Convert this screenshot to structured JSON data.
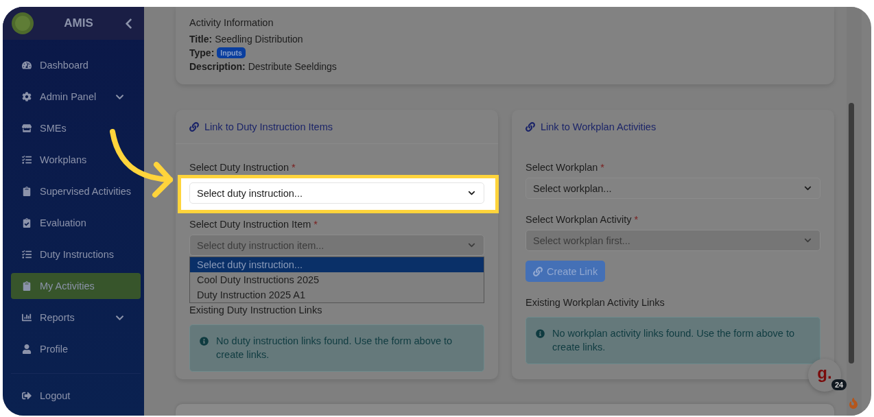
{
  "sidebar": {
    "brand": "AMIS",
    "items": [
      {
        "label": "Dashboard",
        "selected": false,
        "expandable": false
      },
      {
        "label": "Admin Panel",
        "selected": false,
        "expandable": true
      },
      {
        "label": "SMEs",
        "selected": false,
        "expandable": false
      },
      {
        "label": "Workplans",
        "selected": false,
        "expandable": false
      },
      {
        "label": "Supervised Activities",
        "selected": false,
        "expandable": false
      },
      {
        "label": "Evaluation",
        "selected": false,
        "expandable": false
      },
      {
        "label": "Duty Instructions",
        "selected": false,
        "expandable": false
      },
      {
        "label": "My Activities",
        "selected": true,
        "expandable": false
      },
      {
        "label": "Reports",
        "selected": false,
        "expandable": true
      },
      {
        "label": "Profile",
        "selected": false,
        "expandable": false
      }
    ],
    "logout": {
      "label": "Logout"
    }
  },
  "activity_info": {
    "heading": "Activity Information",
    "fields": [
      {
        "label": "Title:",
        "value": "Seedling Distribution",
        "kind": "text"
      },
      {
        "label": "Type:",
        "value": "Inputs",
        "kind": "badge"
      },
      {
        "label": "Description:",
        "value": "Destribute Seeldings",
        "kind": "text"
      }
    ]
  },
  "panels": [
    {
      "title": "Link to Duty Instruction Items",
      "fields": [
        {
          "label": "Select Duty Instruction",
          "required_mark": "*",
          "value": "Select duty instruction...",
          "disabled": false,
          "highlighted": true,
          "open": false
        },
        {
          "label": "Select Duty Instruction Item",
          "required_mark": "*",
          "value": "Select duty instruction item...",
          "disabled": true,
          "highlighted": false,
          "open": true
        }
      ],
      "dropdown": [
        {
          "label": "Select duty instruction...",
          "selected": true
        },
        {
          "label": "Cool Duty Instructions 2025",
          "selected": false
        },
        {
          "label": "Duty Instruction 2025 A1",
          "selected": false
        }
      ],
      "existing_heading": "Existing Duty Instruction Links",
      "alert": "No duty instruction links found. Use the form above to create links."
    },
    {
      "title": "Link to Workplan Activities",
      "fields": [
        {
          "label": "Select Workplan",
          "required_mark": "*",
          "value": "Select workplan...",
          "disabled": false,
          "highlighted": false,
          "open": false
        },
        {
          "label": "Select Workplan Activity",
          "required_mark": "*",
          "value": "Select workplan first...",
          "disabled": true,
          "highlighted": false,
          "open": false
        }
      ],
      "button": {
        "label": "Create Link",
        "disabled": true
      },
      "existing_heading": "Existing Workplan Activity Links",
      "alert": "No workplan activity links found. Use the form above to create links."
    }
  ],
  "chat_button": {
    "glyph": "g.",
    "badge": "24"
  }
}
